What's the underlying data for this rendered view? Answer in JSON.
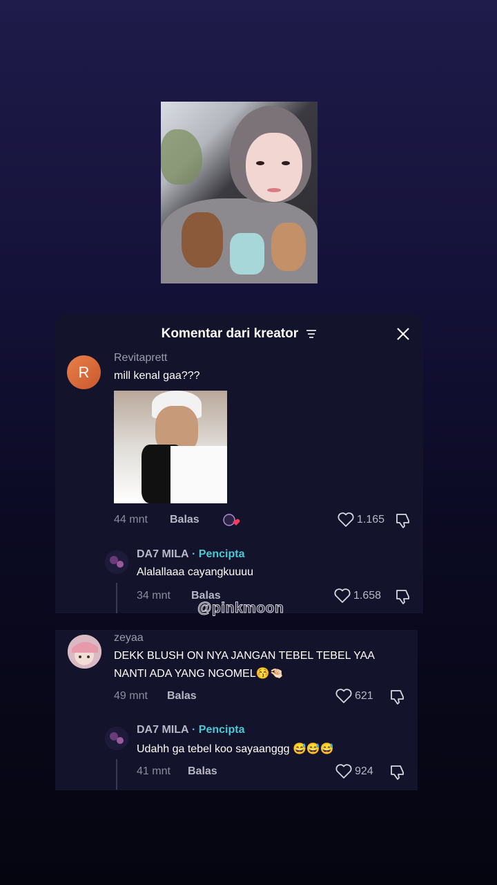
{
  "panel": {
    "title": "Komentar dari kreator",
    "close_icon": "close-icon",
    "filter_icon": "filter-icon"
  },
  "comments": [
    {
      "avatar_letter": "R",
      "username": "Revitaprett",
      "text": "mill kenal gaa???",
      "time": "44 mnt",
      "reply_label": "Balas",
      "likes": "1.165",
      "reply": {
        "username": "DA7 MILA",
        "creator_badge": "· Pencipta",
        "text": "Alalallaaa cayangkuuuu",
        "time": "34 mnt",
        "reply_label": "Balas",
        "likes": "1.658"
      }
    },
    {
      "username": "zeyaa",
      "text_line1": "DEKK BLUSH ON NYA JANGAN TEBEL TEBEL YAA",
      "text_line2": "NANTI ADA YANG NGOMEL😚🤏🏻",
      "time": "49 mnt",
      "reply_label": "Balas",
      "likes": "621",
      "reply": {
        "username": "DA7 MILA",
        "creator_badge": "· Pencipta",
        "text": "Udahh ga tebel koo sayaanggg 😅😅😅",
        "time": "41 mnt",
        "reply_label": "Balas",
        "likes": "924"
      }
    }
  ],
  "watermark": "@pinkmoon"
}
